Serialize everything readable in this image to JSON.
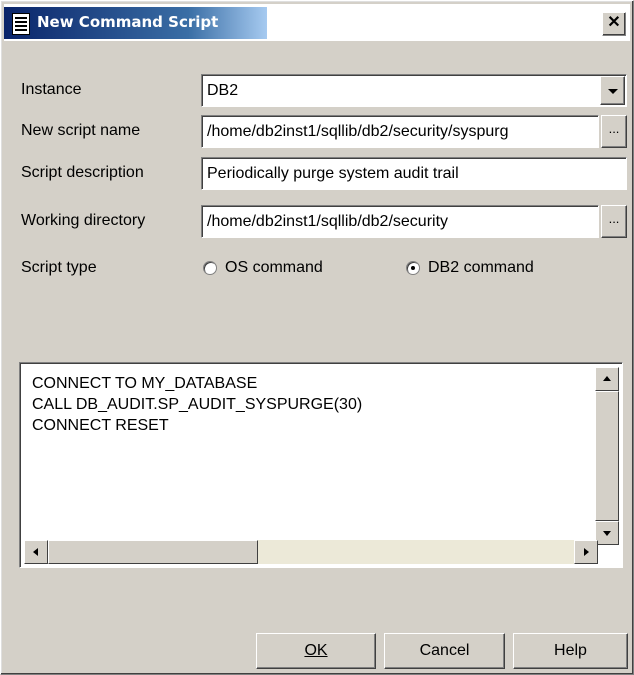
{
  "window": {
    "title": "New Command Script"
  },
  "form": {
    "instance_label": "Instance",
    "instance_value": "DB2",
    "script_name_label": "New script name",
    "script_name_value": "/home/db2inst1/sqllib/db2/security/syspurg",
    "description_label": "Script description",
    "description_value": "Periodically purge system audit trail",
    "working_dir_label": "Working directory",
    "working_dir_value": "/home/db2inst1/sqllib/db2/security",
    "browse_label": "...",
    "script_type_label": "Script type",
    "script_type_options": [
      {
        "label": "OS command",
        "selected": false
      },
      {
        "label": "DB2 command",
        "selected": true
      }
    ]
  },
  "script": {
    "lines": [
      "CONNECT TO MY_DATABASE",
      "CALL DB_AUDIT.SP_AUDIT_SYSPURGE(30)",
      "CONNECT RESET"
    ]
  },
  "buttons": {
    "ok": "OK",
    "cancel": "Cancel",
    "help": "Help"
  },
  "icons": {
    "app": "document-list-icon",
    "close": "close-icon"
  }
}
